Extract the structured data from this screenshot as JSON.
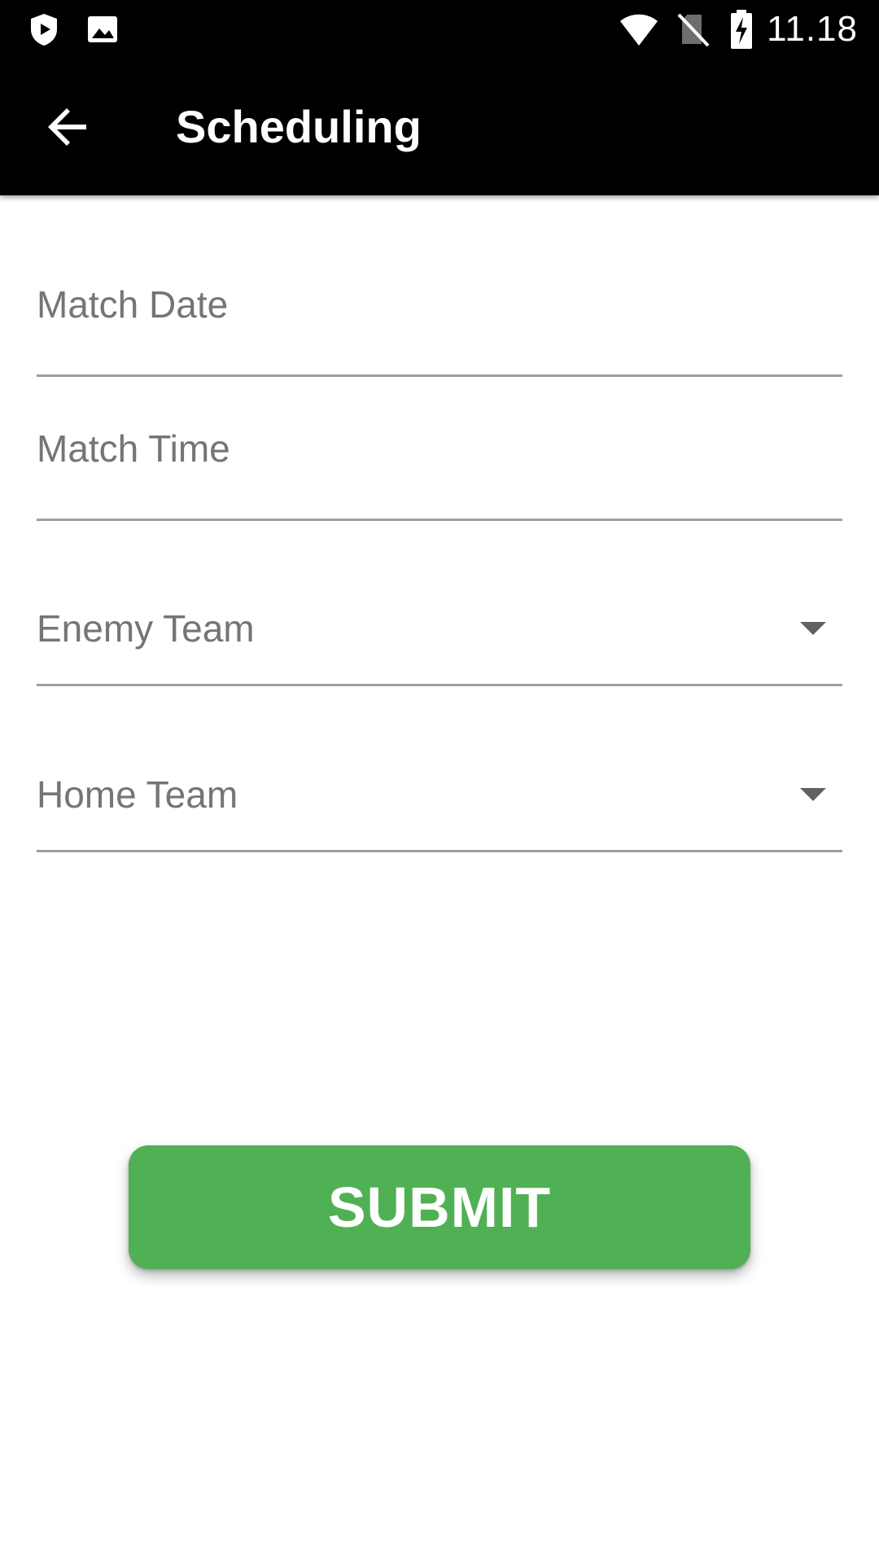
{
  "status_bar": {
    "time": "11.18",
    "icons": [
      "play-shield-icon",
      "image-icon",
      "wifi-icon",
      "no-sim-icon",
      "battery-charging-icon"
    ]
  },
  "app_bar": {
    "title": "Scheduling",
    "back_icon": "arrow-back-icon"
  },
  "form": {
    "match_date": {
      "placeholder": "Match Date"
    },
    "match_time": {
      "placeholder": "Match Time"
    },
    "enemy_team": {
      "label": "Enemy Team"
    },
    "home_team": {
      "label": "Home Team"
    }
  },
  "submit": {
    "label": "SUBMIT"
  },
  "colors": {
    "app_bar_bg": "#000000",
    "accent_green": "#4fb153",
    "label_gray": "#757575",
    "underline_gray": "#9e9e9e"
  }
}
